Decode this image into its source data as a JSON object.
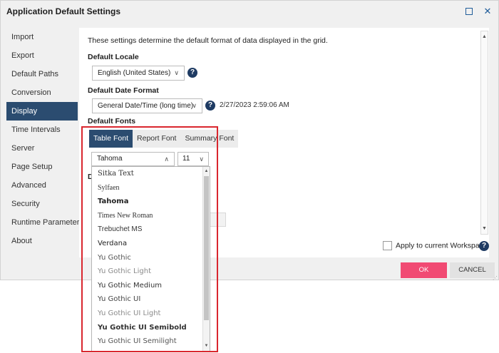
{
  "window": {
    "title": "Application Default Settings",
    "maximize_icon": "maximize-icon",
    "close_icon": "close-icon",
    "close_glyph": "✕"
  },
  "sidebar": {
    "items": [
      {
        "label": "Import",
        "active": false
      },
      {
        "label": "Export",
        "active": false
      },
      {
        "label": "Default Paths",
        "active": false
      },
      {
        "label": "Conversion",
        "active": false
      },
      {
        "label": "Display",
        "active": true
      },
      {
        "label": "Time Intervals",
        "active": false
      },
      {
        "label": "Server",
        "active": false
      },
      {
        "label": "Page Setup",
        "active": false
      },
      {
        "label": "Advanced",
        "active": false
      },
      {
        "label": "Security",
        "active": false
      },
      {
        "label": "Runtime Parameters",
        "active": false
      },
      {
        "label": "About",
        "active": false
      }
    ]
  },
  "display": {
    "description": "These settings determine the default format of data displayed in the grid.",
    "locale": {
      "label": "Default Locale",
      "value": "English (United States)"
    },
    "date_format": {
      "label": "Default Date Format",
      "value": "General Date/Time (long time)",
      "preview": "2/27/2023 2:59:06 AM"
    },
    "fonts": {
      "label": "Default Fonts",
      "tabs": [
        {
          "label": "Table Font",
          "active": true
        },
        {
          "label": "Report Font",
          "active": false
        },
        {
          "label": "Summary Font",
          "active": false
        }
      ],
      "font_value": "Tahoma",
      "size_value": "11",
      "dropdown_items": [
        {
          "label": "Sitka Text",
          "family": "\"DejaVu Serif\", serif",
          "weight": "normal",
          "color": "#333333"
        },
        {
          "label": "Sylfaen",
          "family": "\"Liberation Serif\", serif",
          "weight": "normal",
          "color": "#333333"
        },
        {
          "label": "Tahoma",
          "family": "\"DejaVu Sans\", sans-serif",
          "weight": "bold",
          "color": "#222222"
        },
        {
          "label": "Times New Roman",
          "family": "\"Liberation Serif\", serif",
          "weight": "normal",
          "color": "#333333"
        },
        {
          "label": "Trebuchet MS",
          "family": "\"Liberation Sans\", sans-serif",
          "weight": "normal",
          "color": "#333333"
        },
        {
          "label": "Verdana",
          "family": "\"DejaVu Sans\", sans-serif",
          "weight": "normal",
          "color": "#222222"
        },
        {
          "label": "Yu Gothic",
          "family": "\"DejaVu Sans\", sans-serif",
          "weight": "normal",
          "color": "#555555"
        },
        {
          "label": "Yu Gothic Light",
          "family": "\"DejaVu Sans\", sans-serif",
          "weight": "normal",
          "color": "#8a8a8a"
        },
        {
          "label": "Yu Gothic Medium",
          "family": "\"DejaVu Sans\", sans-serif",
          "weight": "normal",
          "color": "#333333"
        },
        {
          "label": "Yu Gothic UI",
          "family": "\"DejaVu Sans\", sans-serif",
          "weight": "normal",
          "color": "#444444"
        },
        {
          "label": "Yu Gothic UI Light",
          "family": "\"DejaVu Sans\", sans-serif",
          "weight": "normal",
          "color": "#8a8a8a"
        },
        {
          "label": "Yu Gothic UI Semibold",
          "family": "\"DejaVu Sans\", sans-serif",
          "weight": "bold",
          "color": "#333333"
        },
        {
          "label": "Yu Gothic UI Semilight",
          "family": "\"DejaVu Sans\", sans-serif",
          "weight": "normal",
          "color": "#555555"
        }
      ]
    },
    "partial_section_label": "D"
  },
  "footer": {
    "apply_workspace_label": "Apply to current Workspace",
    "apply_workspace_checked": false,
    "ok_label": "OK",
    "cancel_label": "CANCEL"
  },
  "help_glyph": "?",
  "chevron_down_glyph": "∨",
  "chevron_up_glyph": "∧",
  "scroll_up_glyph": "▲",
  "scroll_down_glyph": "▼",
  "colors": {
    "accent": "#2b4c70",
    "ok_button": "#f14a73",
    "help_icon": "#1f3b63",
    "highlight_border": "#d9262e"
  }
}
